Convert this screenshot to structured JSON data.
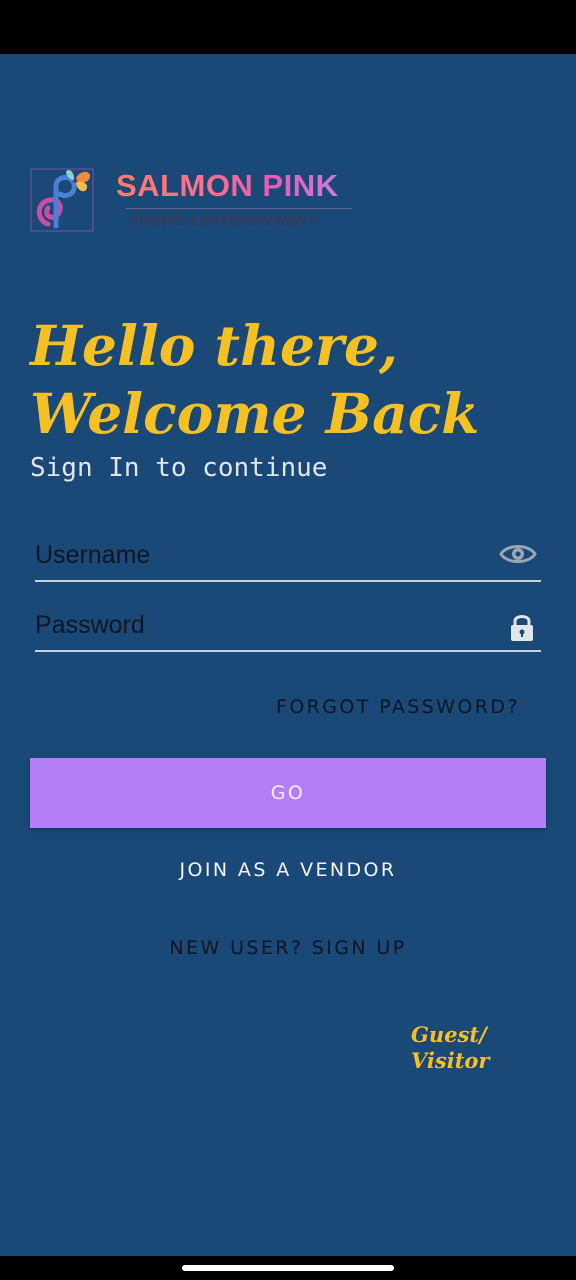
{
  "app": {
    "brand_name": "SALMON PINK",
    "brand_tagline": "EVENTS & ENTERTAINMENT"
  },
  "login": {
    "greeting_line1": "Hello there,",
    "greeting_line2": "Welcome Back",
    "subtitle": "Sign In to continue",
    "username_placeholder": "Username",
    "username_value": "",
    "password_placeholder": "Password",
    "password_value": "",
    "forgot_label": "FORGOT PASSWORD?",
    "go_label": "GO",
    "vendor_label": "JOIN AS A VENDOR",
    "signup_label": "NEW USER? SIGN UP",
    "guest_line1": "Guest/",
    "guest_line2": "Visitor"
  },
  "icons": {
    "visibility": "eye-icon",
    "password_lock": "lock-icon",
    "brand": "butterfly-logo-icon"
  },
  "colors": {
    "background": "#1a4877",
    "accent_yellow": "#f5c023",
    "button_purple": "#b47ef8"
  }
}
